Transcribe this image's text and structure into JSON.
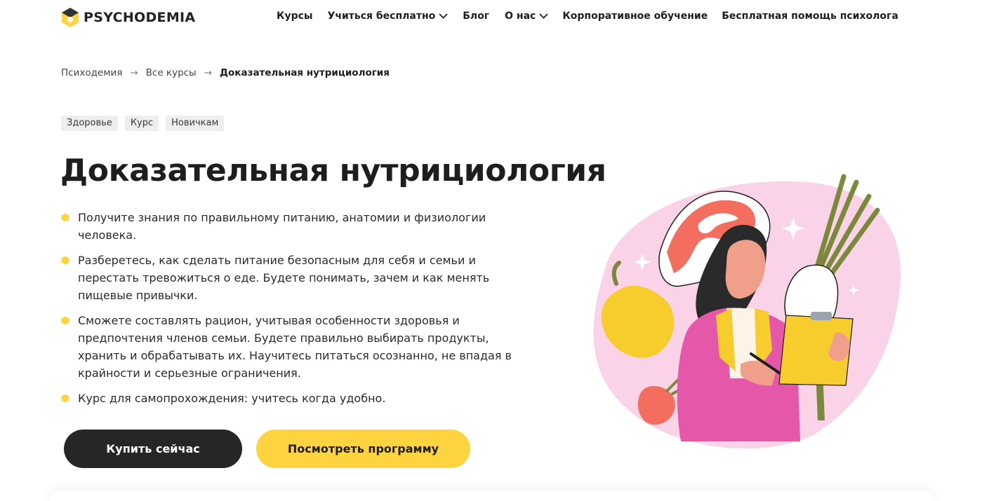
{
  "logo": {
    "text": "PSYCHODEMIA",
    "icon": "hexagon-logo-icon",
    "color": "#fdd33f"
  },
  "nav": {
    "items": [
      {
        "label": "Курсы",
        "dropdown": false
      },
      {
        "label": "Учиться бесплатно",
        "dropdown": true
      },
      {
        "label": "Блог",
        "dropdown": false
      },
      {
        "label": "О нас",
        "dropdown": true
      },
      {
        "label": "Корпоративное обучение",
        "dropdown": false
      },
      {
        "label": "Бесплатная помощь психолога",
        "dropdown": false
      }
    ]
  },
  "breadcrumb": {
    "items": [
      "Психодемия",
      "Все курсы"
    ],
    "separator": "→",
    "current": "Доказательная нутрициология"
  },
  "tags": [
    "Здоровье",
    "Курс",
    "Новичкам"
  ],
  "title": "Доказательная нутрициология",
  "bullets": [
    "Получите знания по правильному питанию, анатомии и физиологии человека.",
    "Разберетесь, как сделать питание безопасным для себя и семьи и перестать тревожиться о еде. Будете понимать, зачем и как менять пищевые привычки.",
    "Сможете составлять рацион, учитывая особенности здоровья и предпочтения членов семьи. Будете правильно выбирать продукты, хранить и обрабатывать их. Научитесь питаться осознанно, не впадая в крайности и серьезные ограничения.",
    "Курс для самопрохождения: учитесь когда удобно."
  ],
  "buttons": {
    "buy": "Купить сейчас",
    "program": "Посмотреть программу"
  },
  "colors": {
    "accent": "#fdd33f",
    "dark": "#262626",
    "pink_bg": "#fbd3e9",
    "jacket": "#e557a8",
    "salmon": "#f36e5e"
  }
}
